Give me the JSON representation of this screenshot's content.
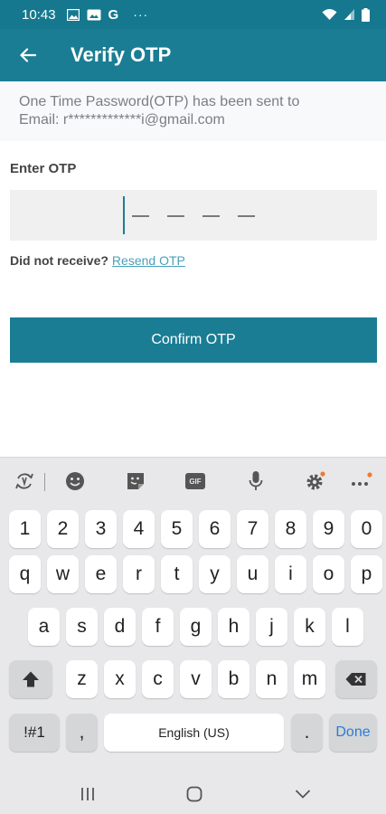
{
  "status_bar": {
    "time": "10:43",
    "g_label": "G",
    "more": "···"
  },
  "app_bar": {
    "title": "Verify OTP"
  },
  "info": {
    "line1": "One Time Password(OTP) has been sent to",
    "line2": "Email: r*************i@gmail.com"
  },
  "otp": {
    "label": "Enter OTP",
    "digits_count": 4
  },
  "resend": {
    "prefix": "Did not receive?",
    "link": "Resend OTP"
  },
  "confirm_button": {
    "label": "Confirm OTP"
  },
  "keyboard": {
    "toolbar_icons": [
      "rotate-icon",
      "emoji-icon",
      "sticker-icon",
      "gif-icon",
      "mic-icon",
      "settings-icon",
      "more-icon"
    ],
    "gif_label": "GIF",
    "row_numbers": [
      "1",
      "2",
      "3",
      "4",
      "5",
      "6",
      "7",
      "8",
      "9",
      "0"
    ],
    "row_1": [
      "q",
      "w",
      "e",
      "r",
      "t",
      "y",
      "u",
      "i",
      "o",
      "p"
    ],
    "row_2": [
      "a",
      "s",
      "d",
      "f",
      "g",
      "h",
      "j",
      "k",
      "l"
    ],
    "row_3": [
      "z",
      "x",
      "c",
      "v",
      "b",
      "n",
      "m"
    ],
    "symbols_label": "!#1",
    "comma": ",",
    "space_label": "English (US)",
    "period": ".",
    "done_label": "Done",
    "done_color": "#2b7bd4"
  },
  "colors": {
    "primary": "#1a7d94",
    "status_bar": "#15788f",
    "link": "#4aa0ba"
  }
}
